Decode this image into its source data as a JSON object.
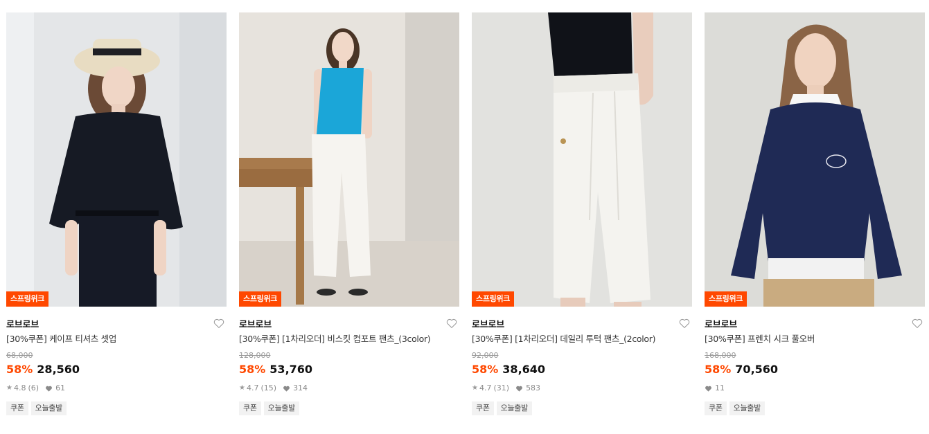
{
  "products": [
    {
      "badge": "스프링위크",
      "brand": "로브로브",
      "name": "[30%쿠폰] 케이프 티셔츠 셋업",
      "original_price": "68,000",
      "discount": "58%",
      "sale_price": "28,560",
      "rating": "4.8",
      "reviews": "(6)",
      "likes": "61",
      "tags": [
        "쿠폰",
        "오늘출발"
      ]
    },
    {
      "badge": "스프링위크",
      "brand": "로브로브",
      "name": "[30%쿠폰] [1차리오더] 비스킷 컴포트 팬츠_(3color)",
      "original_price": "128,000",
      "discount": "58%",
      "sale_price": "53,760",
      "rating": "4.7",
      "reviews": "(15)",
      "likes": "314",
      "tags": [
        "쿠폰",
        "오늘출발"
      ]
    },
    {
      "badge": "스프링위크",
      "brand": "로브로브",
      "name": "[30%쿠폰] [1차리오더] 데일리 투턱 팬츠_(2color)",
      "original_price": "92,000",
      "discount": "58%",
      "sale_price": "38,640",
      "rating": "4.7",
      "reviews": "(31)",
      "likes": "583",
      "tags": [
        "쿠폰",
        "오늘출발"
      ]
    },
    {
      "badge": "스프링위크",
      "brand": "로브로브",
      "name": "[30%쿠폰] 프렌치 시크 풀오버",
      "original_price": "168,000",
      "discount": "58%",
      "sale_price": "70,560",
      "likes": "11",
      "tags": [
        "쿠폰",
        "오늘출발"
      ]
    }
  ],
  "colors": {
    "accent": "#ff4800",
    "tag_bg": "#f2f2f2"
  },
  "icons": {
    "wishlist": "heart-outline-icon",
    "rating": "star-icon",
    "likes": "heart-filled-icon"
  }
}
